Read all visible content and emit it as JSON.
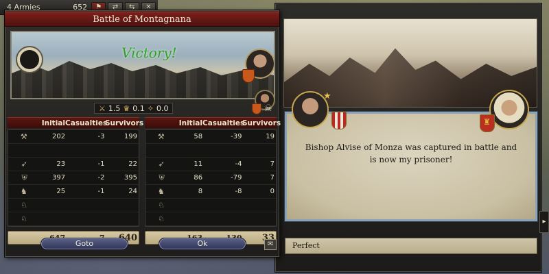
{
  "armies_bar": {
    "label": "4 Armies",
    "count": "652"
  },
  "battle": {
    "title": "Battle of Montagnana",
    "result": "Victory!",
    "stats": {
      "a": "1.5",
      "b": "0.1",
      "c": "0.0"
    },
    "headers": {
      "initial": "Initial",
      "casualties": "Casualties",
      "survivors": "Survivors"
    },
    "attacker_rows": [
      {
        "icon": "light-infantry-icon",
        "initial": "202",
        "casualties": "-3",
        "survivors": "199"
      },
      {
        "icon": "empty",
        "initial": "",
        "casualties": "",
        "survivors": ""
      },
      {
        "icon": "archer-icon",
        "initial": "23",
        "casualties": "-1",
        "survivors": "22"
      },
      {
        "icon": "heavy-infantry-icon",
        "initial": "397",
        "casualties": "-2",
        "survivors": "395"
      },
      {
        "icon": "pikemen-icon",
        "initial": "25",
        "casualties": "-1",
        "survivors": "24"
      },
      {
        "icon": "empty",
        "initial": "",
        "casualties": "",
        "survivors": ""
      },
      {
        "icon": "empty",
        "initial": "",
        "casualties": "",
        "survivors": ""
      }
    ],
    "defender_rows": [
      {
        "icon": "light-infantry-icon",
        "initial": "58",
        "casualties": "-39",
        "survivors": "19"
      },
      {
        "icon": "empty",
        "initial": "",
        "casualties": "",
        "survivors": ""
      },
      {
        "icon": "archer-icon",
        "initial": "11",
        "casualties": "-4",
        "survivors": "7"
      },
      {
        "icon": "heavy-infantry-icon",
        "initial": "86",
        "casualties": "-79",
        "survivors": "7"
      },
      {
        "icon": "pikemen-icon",
        "initial": "8",
        "casualties": "-8",
        "survivors": "0"
      },
      {
        "icon": "empty",
        "initial": "",
        "casualties": "",
        "survivors": ""
      },
      {
        "icon": "empty",
        "initial": "",
        "casualties": "",
        "survivors": ""
      }
    ],
    "attacker_total": {
      "initial": "647",
      "casualties": "-7",
      "survivors": "640"
    },
    "defender_total": {
      "initial": "163",
      "casualties": "-130",
      "survivors": "33"
    },
    "goto_label": "Goto",
    "ok_label": "Ok"
  },
  "event": {
    "text": "Bishop Alvise of Monza was captured in battle and is now my prisoner!",
    "option_label": "Perfect"
  },
  "colors": {
    "victory": "#2e9f2c",
    "title_bar": "#7d1f1a",
    "button": "#3f446b"
  }
}
